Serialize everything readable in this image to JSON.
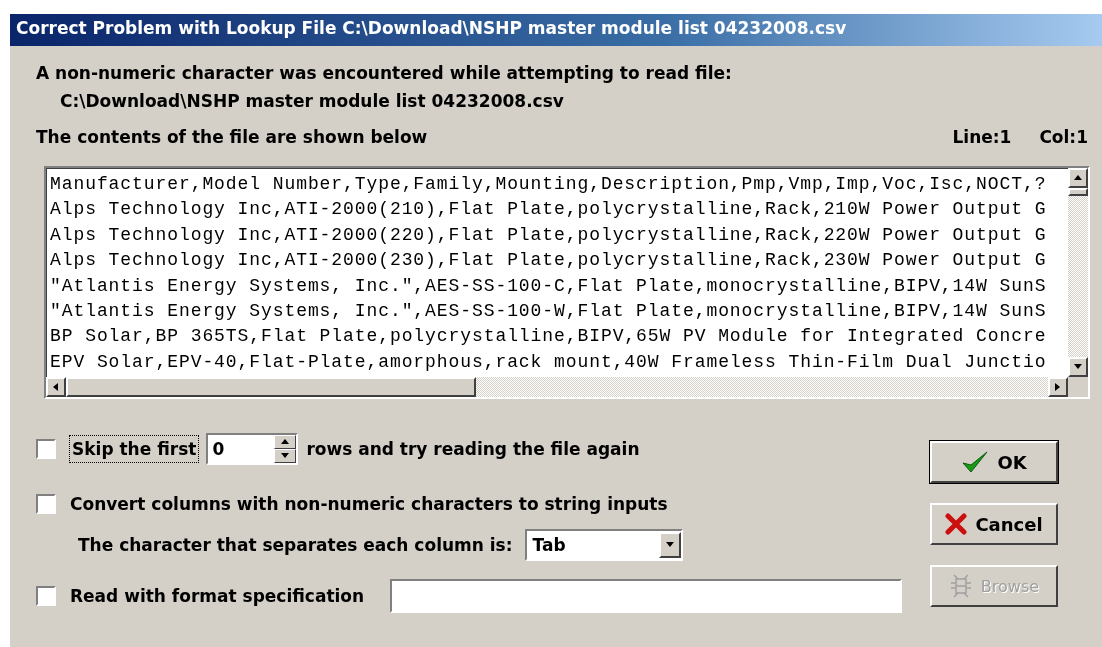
{
  "window": {
    "title": "Correct Problem with Lookup File  C:\\Download\\NSHP master module list 04232008.csv"
  },
  "message": {
    "line": "A non-numeric character was encountered while attempting to read file:",
    "path": "C:\\Download\\NSHP master module list 04232008.csv"
  },
  "contents_label": "The contents of the file are shown below",
  "cursor": {
    "line": "Line:1",
    "col": "Col:1"
  },
  "file_lines": [
    "Manufacturer,Model Number,Type,Family,Mounting,Description,Pmp,Vmp,Imp,Voc,Isc,NOCT,?",
    "Alps Technology Inc,ATI-2000(210),Flat Plate,polycrystalline,Rack,210W Power Output G",
    "Alps Technology Inc,ATI-2000(220),Flat Plate,polycrystalline,Rack,220W Power Output G",
    "Alps Technology Inc,ATI-2000(230),Flat Plate,polycrystalline,Rack,230W Power Output G",
    "\"Atlantis Energy Systems, Inc.\",AES-SS-100-C,Flat Plate,monocrystalline,BIPV,14W SunS",
    "\"Atlantis Energy Systems, Inc.\",AES-SS-100-W,Flat Plate,monocrystalline,BIPV,14W SunS",
    "BP Solar,BP 365TS,Flat Plate,polycrystalline,BIPV,65W PV Module for Integrated Concre",
    "EPV Solar,EPV-40,Flat-Plate,amorphous,rack mount,40W Frameless Thin-Film Dual Junctio"
  ],
  "options": [
    {
      "kind": "skip",
      "label": "Skip the first",
      "checked": false,
      "value": "0",
      "suffix": "rows and try reading the file again"
    },
    {
      "kind": "convert",
      "label": "Convert columns with non-numeric characters to string inputs",
      "checked": false,
      "separator_label": "The character that separates each column is:",
      "separator": "Tab"
    },
    {
      "kind": "format",
      "label": "Read with format specification",
      "checked": false
    }
  ],
  "buttons": [
    {
      "kind": "ok",
      "label": "OK",
      "disabled": false
    },
    {
      "kind": "cancel",
      "label": "Cancel",
      "disabled": false
    },
    {
      "kind": "browse",
      "label": "Browse",
      "disabled": true
    }
  ]
}
